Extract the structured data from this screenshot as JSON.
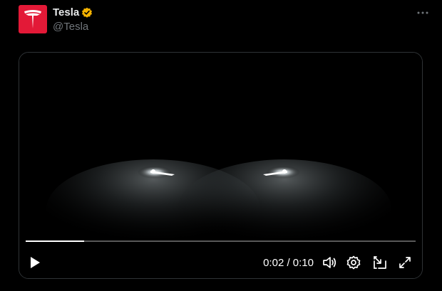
{
  "tweet": {
    "display_name": "Tesla",
    "handle": "@Tesla",
    "verified": true,
    "avatar_icon": "tesla-logo-icon",
    "brand_color": "#e31937",
    "verified_color": "#f5b301"
  },
  "video": {
    "current_time": "0:02",
    "separator": "/",
    "duration": "0:10",
    "time_display": "0:02 / 0:10",
    "progress_fraction": 0.15,
    "controls": {
      "play": "play-icon",
      "volume": "volume-icon",
      "settings": "settings-icon",
      "pip": "picture-in-picture-icon",
      "fullscreen": "fullscreen-icon"
    }
  }
}
